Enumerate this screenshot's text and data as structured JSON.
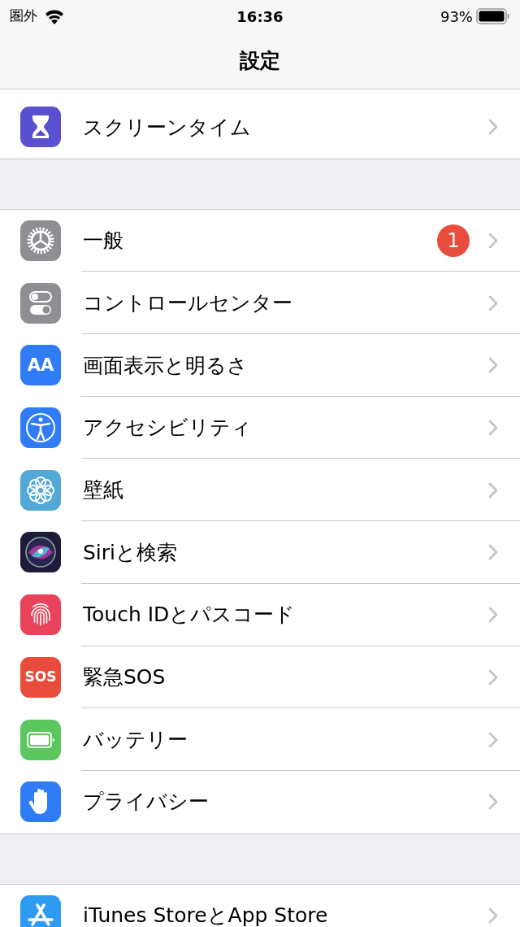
{
  "status_bar": {
    "carrier": "圏外",
    "time": "16:36",
    "battery": "93%"
  },
  "nav": {
    "title": "設定"
  },
  "sections": [
    {
      "items": [
        {
          "label": "スクリーンタイム",
          "kind": "hourglass",
          "color": "#5a4fcf"
        }
      ]
    },
    {
      "items": [
        {
          "label": "一般",
          "kind": "gear",
          "color": "#8e8e93",
          "badge": "1"
        },
        {
          "label": "コントロールセンター",
          "kind": "toggles",
          "color": "#8e8e93"
        },
        {
          "label": "画面表示と明るさ",
          "kind": "text",
          "icon_label": "AA",
          "color": "#2f7cf6"
        },
        {
          "label": "アクセシビリティ",
          "kind": "person",
          "color": "#2f7cf6"
        },
        {
          "label": "壁紙",
          "kind": "flower",
          "color": "#52a8d6"
        },
        {
          "label": "Siriと検索",
          "kind": "orb",
          "color": "#1c1c3a"
        },
        {
          "label": "Touch IDとパスコード",
          "kind": "fingerprint",
          "color": "#e8435a"
        },
        {
          "label": "緊急SOS",
          "kind": "text",
          "icon_label": "SOS",
          "color": "#e84c3d"
        },
        {
          "label": "バッテリー",
          "kind": "battery",
          "color": "#5cc65f"
        },
        {
          "label": "プライバシー",
          "kind": "hand",
          "color": "#2f7cf6"
        }
      ]
    },
    {
      "items": [
        {
          "label": "iTunes StoreとApp Store",
          "kind": "appstore",
          "color": "#2d9bf0"
        }
      ]
    }
  ]
}
